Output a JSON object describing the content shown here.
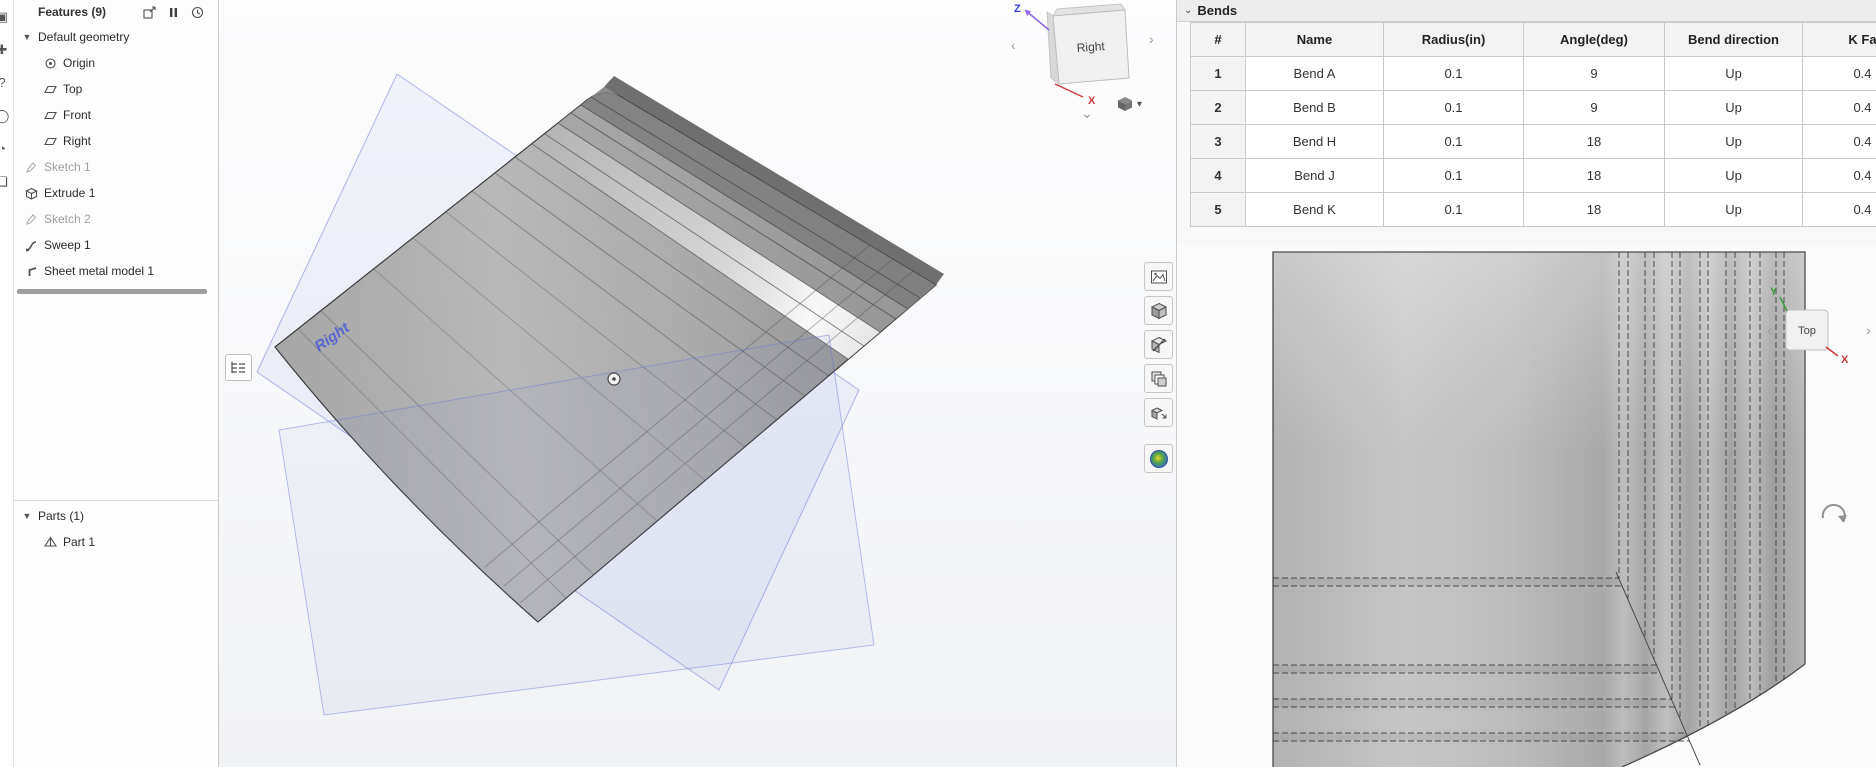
{
  "colors": {
    "accent_plane_blue": "#5968cf",
    "axis_z_blue": "#3340cf",
    "axis_x_red": "#cc3b3b",
    "axis_y_green": "#3a9b3a",
    "model_gray": "#a8a8a8"
  },
  "features_panel": {
    "title": "Features (9)",
    "header_icons": [
      "insert-icon",
      "pause-icon",
      "history-icon"
    ],
    "tree": [
      {
        "label": "Default geometry",
        "type": "group"
      },
      {
        "label": "Origin",
        "type": "origin"
      },
      {
        "label": "Top",
        "type": "plane"
      },
      {
        "label": "Front",
        "type": "plane"
      },
      {
        "label": "Right",
        "type": "plane"
      },
      {
        "label": "Sketch 1",
        "type": "sketch",
        "muted": true
      },
      {
        "label": "Extrude 1",
        "type": "extrude"
      },
      {
        "label": "Sketch 2",
        "type": "sketch",
        "muted": true
      },
      {
        "label": "Sweep 1",
        "type": "sweep"
      },
      {
        "label": "Sheet metal model 1",
        "type": "sheetmetal"
      }
    ],
    "parts_title": "Parts (1)",
    "parts": [
      {
        "label": "Part 1"
      }
    ]
  },
  "viewport": {
    "plane_label": "Right",
    "view_cube": {
      "face": "Right",
      "z": "Z",
      "x": "X"
    },
    "display_toolbar_icons": [
      "named-views-icon",
      "shaded-cube-icon",
      "section-cube-icon",
      "layered-views-icon",
      "exploded-cube-icon",
      "appearance-sphere-icon"
    ]
  },
  "flat_view": {
    "view_cube": {
      "face": "Top",
      "y": "Y",
      "x": "X"
    }
  },
  "bends": {
    "title": "Bends",
    "headers": [
      "#",
      "Name",
      "Radius(in)",
      "Angle(deg)",
      "Bend direction",
      "K Fa"
    ],
    "rows": [
      {
        "num": "1",
        "name": "Bend A",
        "radius": "0.1",
        "angle": "9",
        "direction": "Up",
        "k": "0.4"
      },
      {
        "num": "2",
        "name": "Bend B",
        "radius": "0.1",
        "angle": "9",
        "direction": "Up",
        "k": "0.4"
      },
      {
        "num": "3",
        "name": "Bend H",
        "radius": "0.1",
        "angle": "18",
        "direction": "Up",
        "k": "0.4"
      },
      {
        "num": "4",
        "name": "Bend J",
        "radius": "0.1",
        "angle": "18",
        "direction": "Up",
        "k": "0.4"
      },
      {
        "num": "5",
        "name": "Bend K",
        "radius": "0.1",
        "angle": "18",
        "direction": "Up",
        "k": "0.4"
      }
    ]
  }
}
